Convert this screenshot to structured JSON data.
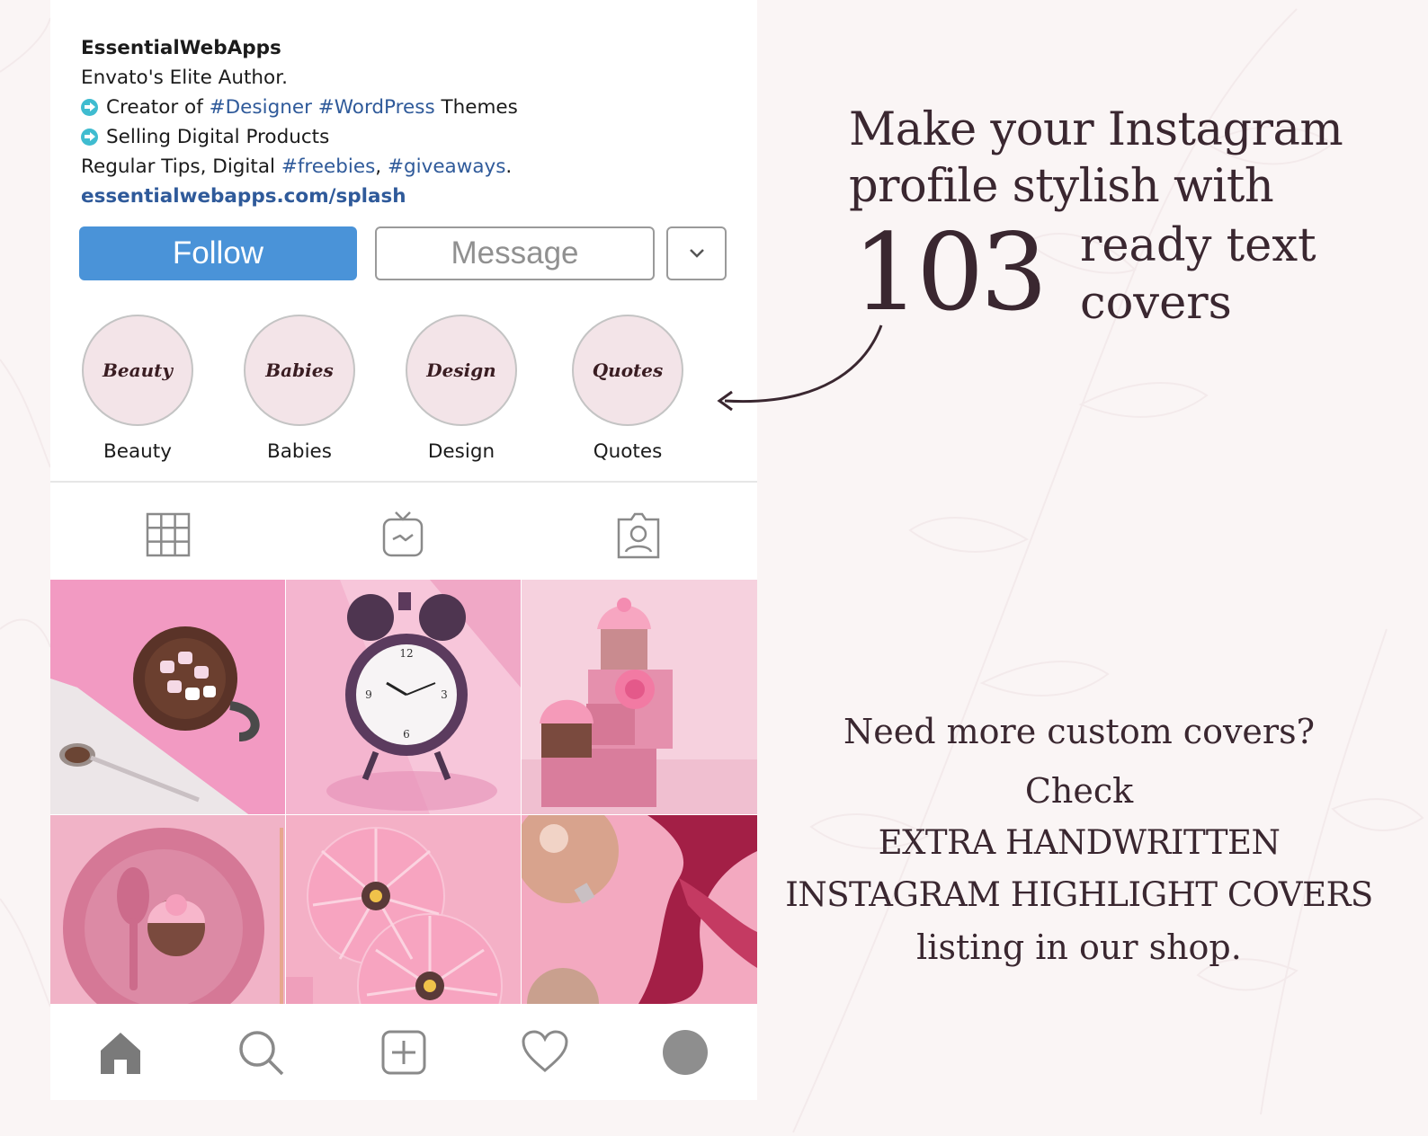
{
  "profile": {
    "username": "EssentialWebApps",
    "bio_line1": "Envato's Elite Author.",
    "bio_line2_prefix": "Creator of ",
    "bio_line2_tag1": "#Designer",
    "bio_line2_tag2": "#WordPress",
    "bio_line2_suffix": " Themes",
    "bio_line3": "Selling Digital Products",
    "bio_line4_prefix": "Regular Tips, Digital ",
    "bio_line4_tag1": "#freebies",
    "bio_line4_sep": ", ",
    "bio_line4_tag2": "#giveaways",
    "bio_line4_end": ".",
    "link": "essentialwebapps.com/splash"
  },
  "actions": {
    "follow_label": "Follow",
    "message_label": "Message",
    "more_icon": "chevron-down-icon"
  },
  "highlights": [
    {
      "cover": "Beauty",
      "label": "Beauty"
    },
    {
      "cover": "Babies",
      "label": "Babies"
    },
    {
      "cover": "Design",
      "label": "Design"
    },
    {
      "cover": "Quotes",
      "label": "Quotes"
    }
  ],
  "tabs": [
    "grid-icon",
    "igtv-icon",
    "tagged-icon"
  ],
  "posts": [
    "hot-chocolate-photo",
    "alarm-clock-photo",
    "cupcakes-photo",
    "plate-cupcake-photo",
    "gerbera-flowers-photo",
    "ornament-ribbon-photo"
  ],
  "bottom_nav": [
    "home-icon",
    "search-icon",
    "add-post-icon",
    "heart-icon",
    "profile-avatar"
  ],
  "headline": {
    "line1": "Make your Instagram",
    "line2": "profile stylish with",
    "number": "103",
    "suffix_line1": "ready text",
    "suffix_line2": "covers"
  },
  "promo": {
    "line1": "Need more custom covers?",
    "line2": "Check",
    "line3": "EXTRA HANDWRITTEN",
    "line4": "INSTAGRAM HIGHLIGHT COVERS",
    "line5": "listing in our shop."
  },
  "colors": {
    "follow_blue": "#4a93d8",
    "hashtag_blue": "#2f5a9a",
    "text_dark": "#3a2730",
    "highlight_fill": "#f3e4e8",
    "background": "#faf5f5"
  }
}
